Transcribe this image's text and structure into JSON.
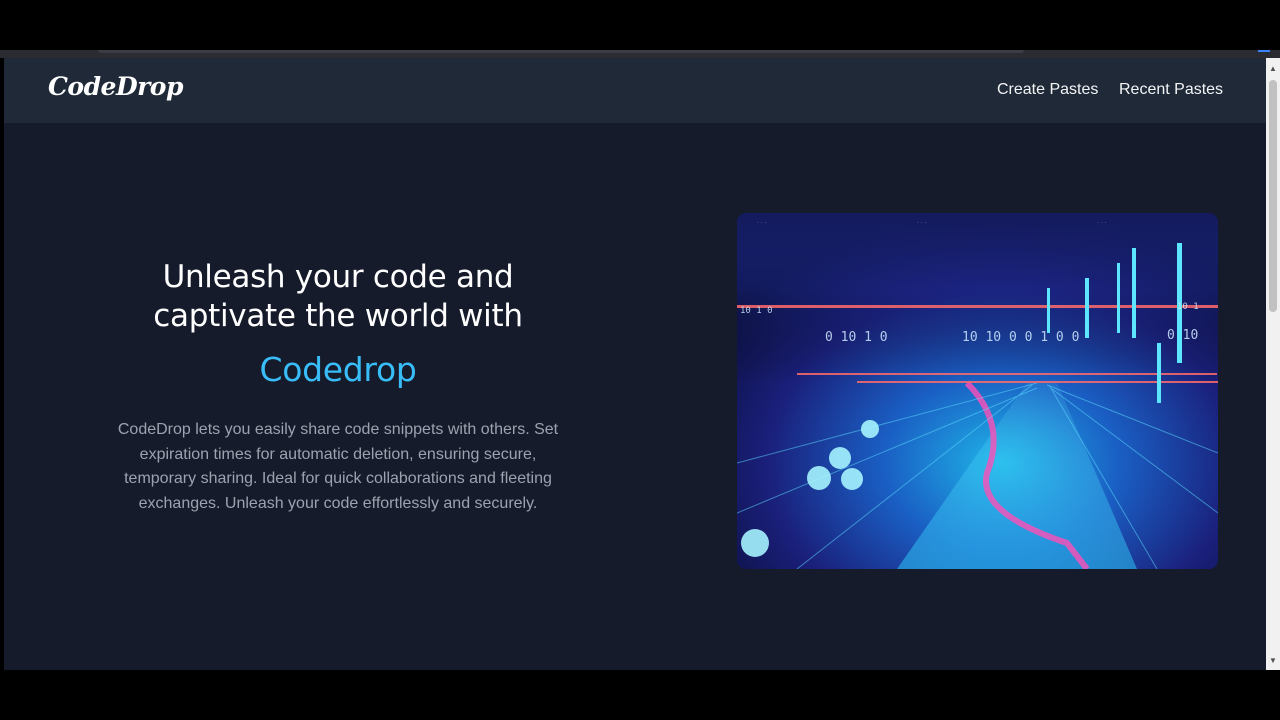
{
  "navbar": {
    "logo": "CodeDrop",
    "links": [
      {
        "label": "Create Pastes"
      },
      {
        "label": "Recent Pastes"
      }
    ]
  },
  "hero": {
    "title_line1": "Unleash your code and",
    "title_line2": "captivate the world with",
    "brand": "Codedrop",
    "description": "CodeDrop lets you easily share code snippets with others. Set expiration times for automatic deletion, ensuring secure, temporary sharing. Ideal for quick collaborations and fleeting exchanges. Unleash your code effortlessly and securely."
  },
  "colors": {
    "page_background": "#151b2b",
    "navbar_background": "#1f2937",
    "brand_accent": "#38bdf8",
    "description_text": "#9ca3af"
  },
  "icons": {
    "scroll_up": "triangle-up-icon",
    "scroll_down": "triangle-down-icon"
  }
}
